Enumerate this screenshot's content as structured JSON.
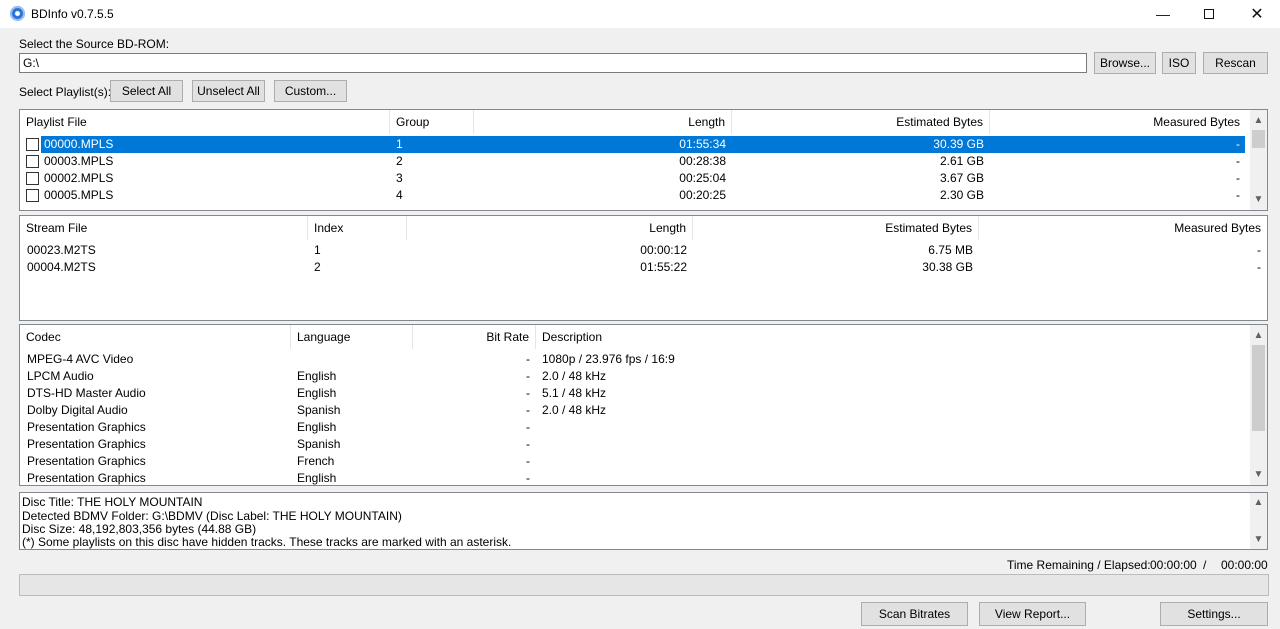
{
  "window": {
    "title": "BDInfo v0.7.5.5"
  },
  "source": {
    "label": "Select the Source BD-ROM:",
    "path": "G:\\",
    "browse_label": "Browse...",
    "iso_label": "ISO",
    "rescan_label": "Rescan"
  },
  "playlist_controls": {
    "label": "Select Playlist(s):",
    "select_all": "Select All",
    "unselect_all": "Unselect All",
    "custom": "Custom..."
  },
  "playlists": {
    "headers": [
      "Playlist File",
      "Group",
      "Length",
      "Estimated Bytes",
      "Measured Bytes"
    ],
    "rows": [
      {
        "file": "00000.MPLS",
        "group": "1",
        "length": "01:55:34",
        "estimated": "30.39 GB",
        "measured": "-"
      },
      {
        "file": "00003.MPLS",
        "group": "2",
        "length": "00:28:38",
        "estimated": "2.61 GB",
        "measured": "-"
      },
      {
        "file": "00002.MPLS",
        "group": "3",
        "length": "00:25:04",
        "estimated": "3.67 GB",
        "measured": "-"
      },
      {
        "file": "00005.MPLS",
        "group": "4",
        "length": "00:20:25",
        "estimated": "2.30 GB",
        "measured": "-"
      }
    ]
  },
  "streams": {
    "headers": [
      "Stream File",
      "Index",
      "Length",
      "Estimated Bytes",
      "Measured Bytes"
    ],
    "rows": [
      {
        "file": "00023.M2TS",
        "index": "1",
        "length": "00:00:12",
        "estimated": "6.75 MB",
        "measured": "-"
      },
      {
        "file": "00004.M2TS",
        "index": "2",
        "length": "01:55:22",
        "estimated": "30.38 GB",
        "measured": "-"
      }
    ]
  },
  "codecs": {
    "headers": [
      "Codec",
      "Language",
      "Bit Rate",
      "Description"
    ],
    "rows": [
      {
        "codec": "MPEG-4 AVC Video",
        "language": "",
        "bitrate": "-",
        "description": "1080p / 23.976 fps / 16:9"
      },
      {
        "codec": "LPCM Audio",
        "language": "English",
        "bitrate": "-",
        "description": "2.0 / 48 kHz"
      },
      {
        "codec": "DTS-HD Master Audio",
        "language": "English",
        "bitrate": "-",
        "description": "5.1 / 48 kHz"
      },
      {
        "codec": "Dolby Digital Audio",
        "language": "Spanish",
        "bitrate": "-",
        "description": "2.0 / 48 kHz"
      },
      {
        "codec": "Presentation Graphics",
        "language": "English",
        "bitrate": "-",
        "description": ""
      },
      {
        "codec": "Presentation Graphics",
        "language": "Spanish",
        "bitrate": "-",
        "description": ""
      },
      {
        "codec": "Presentation Graphics",
        "language": "French",
        "bitrate": "-",
        "description": ""
      },
      {
        "codec": "Presentation Graphics",
        "language": "English",
        "bitrate": "-",
        "description": ""
      }
    ]
  },
  "disc_info": {
    "lines": [
      "Disc Title: THE HOLY MOUNTAIN",
      "Detected BDMV Folder: G:\\BDMV (Disc Label: THE HOLY MOUNTAIN)",
      "Disc Size: 48,192,803,356 bytes (44.88 GB)",
      "(*) Some playlists on this disc have hidden tracks. These tracks are marked with an asterisk."
    ]
  },
  "status": {
    "time_label": "Time Remaining / Elapsed:",
    "remaining": "00:00:00",
    "separator": "/",
    "elapsed": "00:00:00"
  },
  "actions": {
    "scan_bitrates": "Scan Bitrates",
    "view_report": "View Report...",
    "settings": "Settings..."
  }
}
